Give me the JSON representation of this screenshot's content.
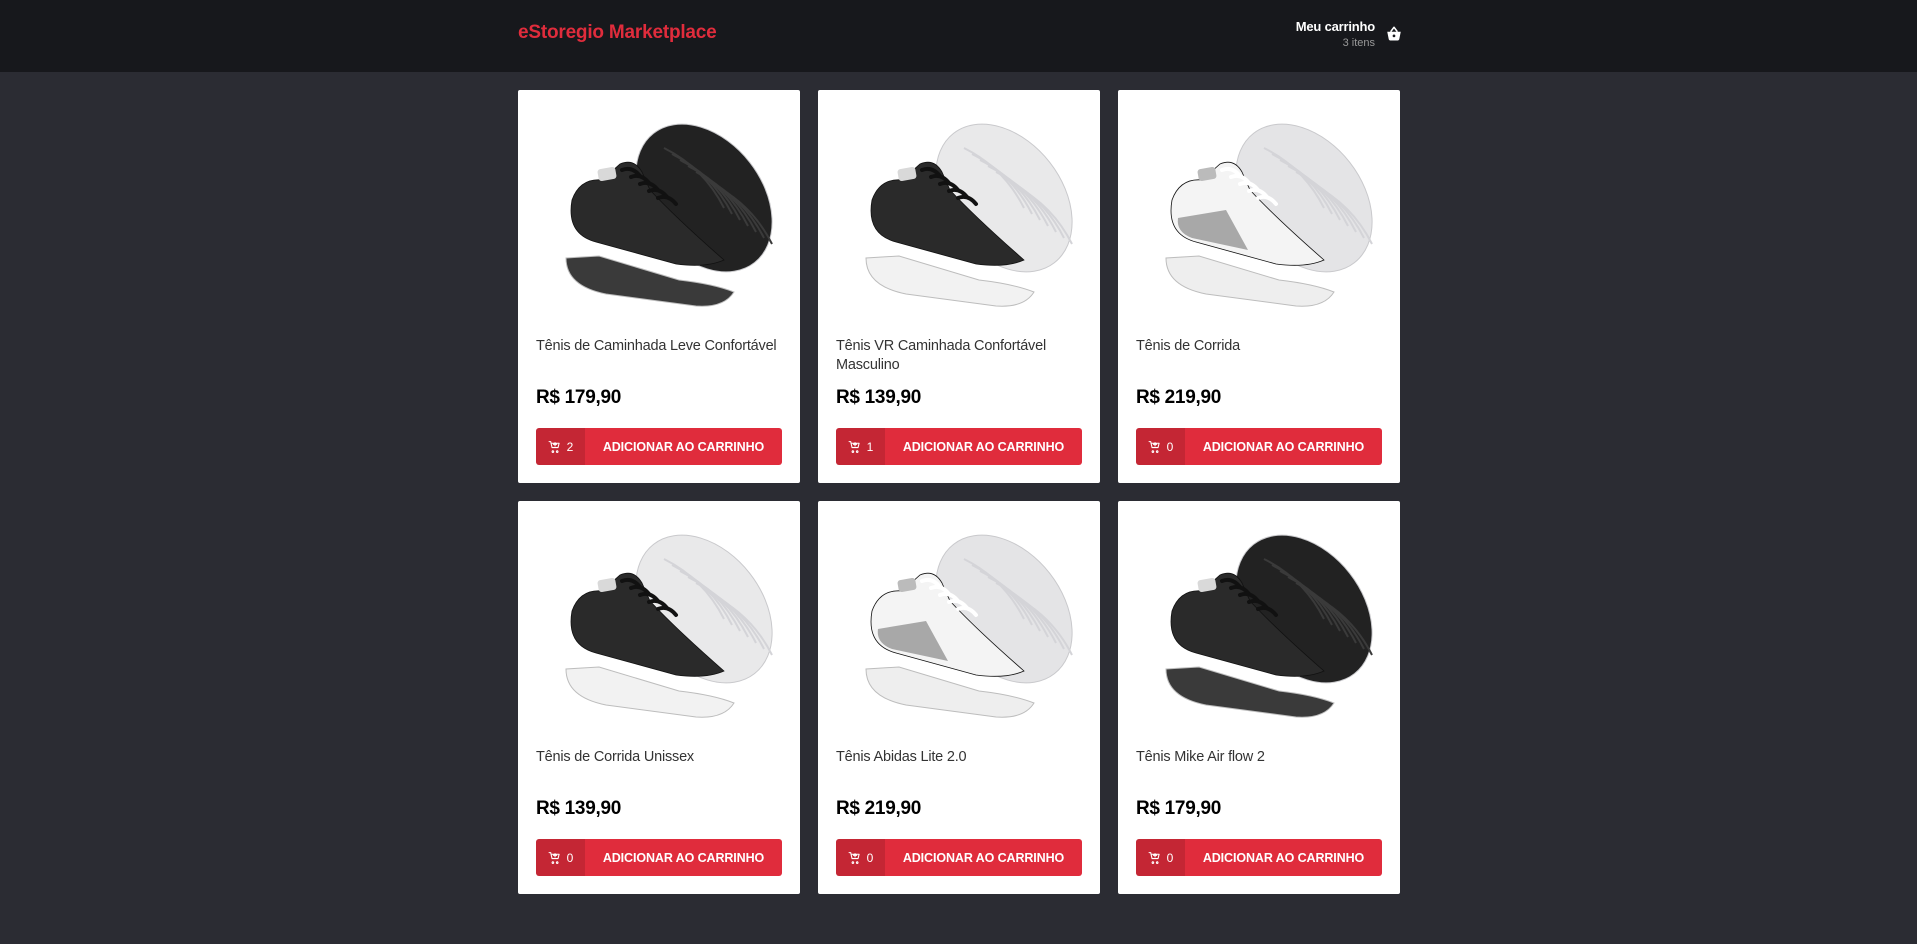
{
  "header": {
    "logo": "eStoregio Marketplace",
    "cart": {
      "title": "Meu carrinho",
      "count_label": "3 itens",
      "icon": "basket-icon"
    }
  },
  "theme": {
    "accent": "#e02c3c",
    "background": "#2b2c33",
    "header_bg": "#17181c"
  },
  "products": [
    {
      "title": "Tênis de Caminhada Leve Confortável",
      "price": "R$ 179,90",
      "cart_qty": "2",
      "button_label": "ADICIONAR AO CARRINHO",
      "upper": "#2a2a2a",
      "sole": "#3a3a3a",
      "back_sole": "#222222"
    },
    {
      "title": "Tênis VR Caminhada Confortável Masculino",
      "price": "R$ 139,90",
      "cart_qty": "1",
      "button_label": "ADICIONAR AO CARRINHO",
      "upper": "#2a2a2a",
      "sole": "#f2f2f2",
      "back_sole": "#e9e9ea"
    },
    {
      "title": "Tênis de Corrida",
      "price": "R$ 219,90",
      "cart_qty": "0",
      "button_label": "ADICIONAR AO CARRINHO",
      "upper": "#f4f4f4",
      "sole": "#eeeeee",
      "back_sole": "#e4e4e6",
      "accent_panel": "#9a9a9a"
    },
    {
      "title": "Tênis de Corrida Unissex",
      "price": "R$ 139,90",
      "cart_qty": "0",
      "button_label": "ADICIONAR AO CARRINHO",
      "upper": "#2a2a2a",
      "sole": "#f2f2f2",
      "back_sole": "#e9e9ea"
    },
    {
      "title": "Tênis Abidas Lite 2.0",
      "price": "R$ 219,90",
      "cart_qty": "0",
      "button_label": "ADICIONAR AO CARRINHO",
      "upper": "#f4f4f4",
      "sole": "#eeeeee",
      "back_sole": "#e4e4e6",
      "accent_panel": "#9a9a9a"
    },
    {
      "title": "Tênis Mike Air flow 2",
      "price": "R$ 179,90",
      "cart_qty": "0",
      "button_label": "ADICIONAR AO CARRINHO",
      "upper": "#2a2a2a",
      "sole": "#3a3a3a",
      "back_sole": "#222222"
    }
  ]
}
